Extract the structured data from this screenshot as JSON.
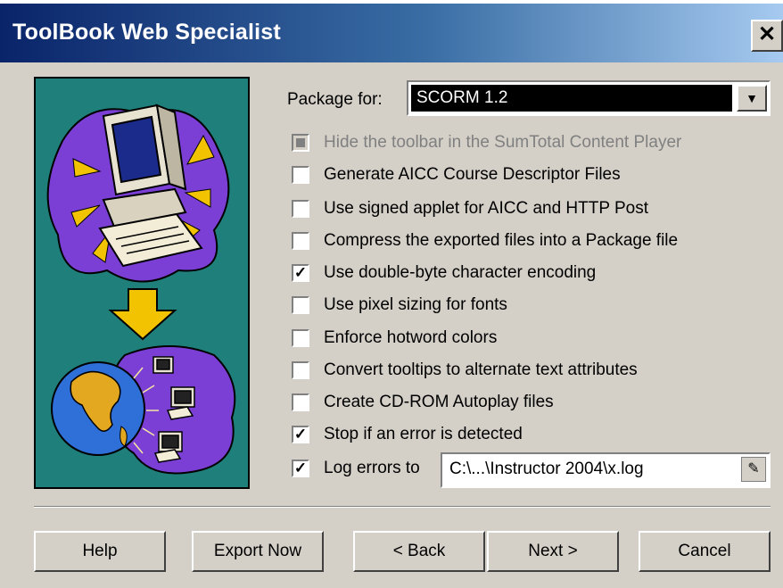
{
  "window": {
    "title": "ToolBook Web Specialist",
    "close_glyph": "✕"
  },
  "package": {
    "label": "Package for:",
    "selected": "SCORM 1.2"
  },
  "options": [
    {
      "label": "Hide the toolbar in the SumTotal Content Player",
      "checked": false,
      "disabled": true
    },
    {
      "label": "Generate AICC Course Descriptor Files",
      "checked": false,
      "disabled": false
    },
    {
      "label": "Use signed applet for AICC and HTTP Post",
      "checked": false,
      "disabled": false
    },
    {
      "label": "Compress the exported files into a Package file",
      "checked": false,
      "disabled": false
    },
    {
      "label": "Use double-byte character encoding",
      "checked": true,
      "disabled": false
    },
    {
      "label": "Use pixel sizing for fonts",
      "checked": false,
      "disabled": false
    },
    {
      "label": "Enforce hotword colors",
      "checked": false,
      "disabled": false
    },
    {
      "label": "Convert tooltips to alternate text attributes",
      "checked": false,
      "disabled": false
    },
    {
      "label": "Create CD-ROM Autoplay files",
      "checked": false,
      "disabled": false
    },
    {
      "label": "Stop if an error is detected",
      "checked": true,
      "disabled": false
    },
    {
      "label": "Log errors to",
      "checked": true,
      "disabled": false
    }
  ],
  "log": {
    "path": "C:\\...\\Instructor 2004\\x.log",
    "edit_icon": "edit-icon"
  },
  "buttons": {
    "help": "Help",
    "export": "Export Now",
    "back": "< Back",
    "next": "Next >",
    "cancel": "Cancel"
  },
  "illustration": {
    "icons": [
      "computer-icon",
      "down-arrow-icon",
      "globe-icon",
      "networked-computers-icon"
    ]
  },
  "colors": {
    "panel_background": "#1f7f7a",
    "title_gradient_start": "#0a246a",
    "dialog_face": "#d4d0c8"
  }
}
